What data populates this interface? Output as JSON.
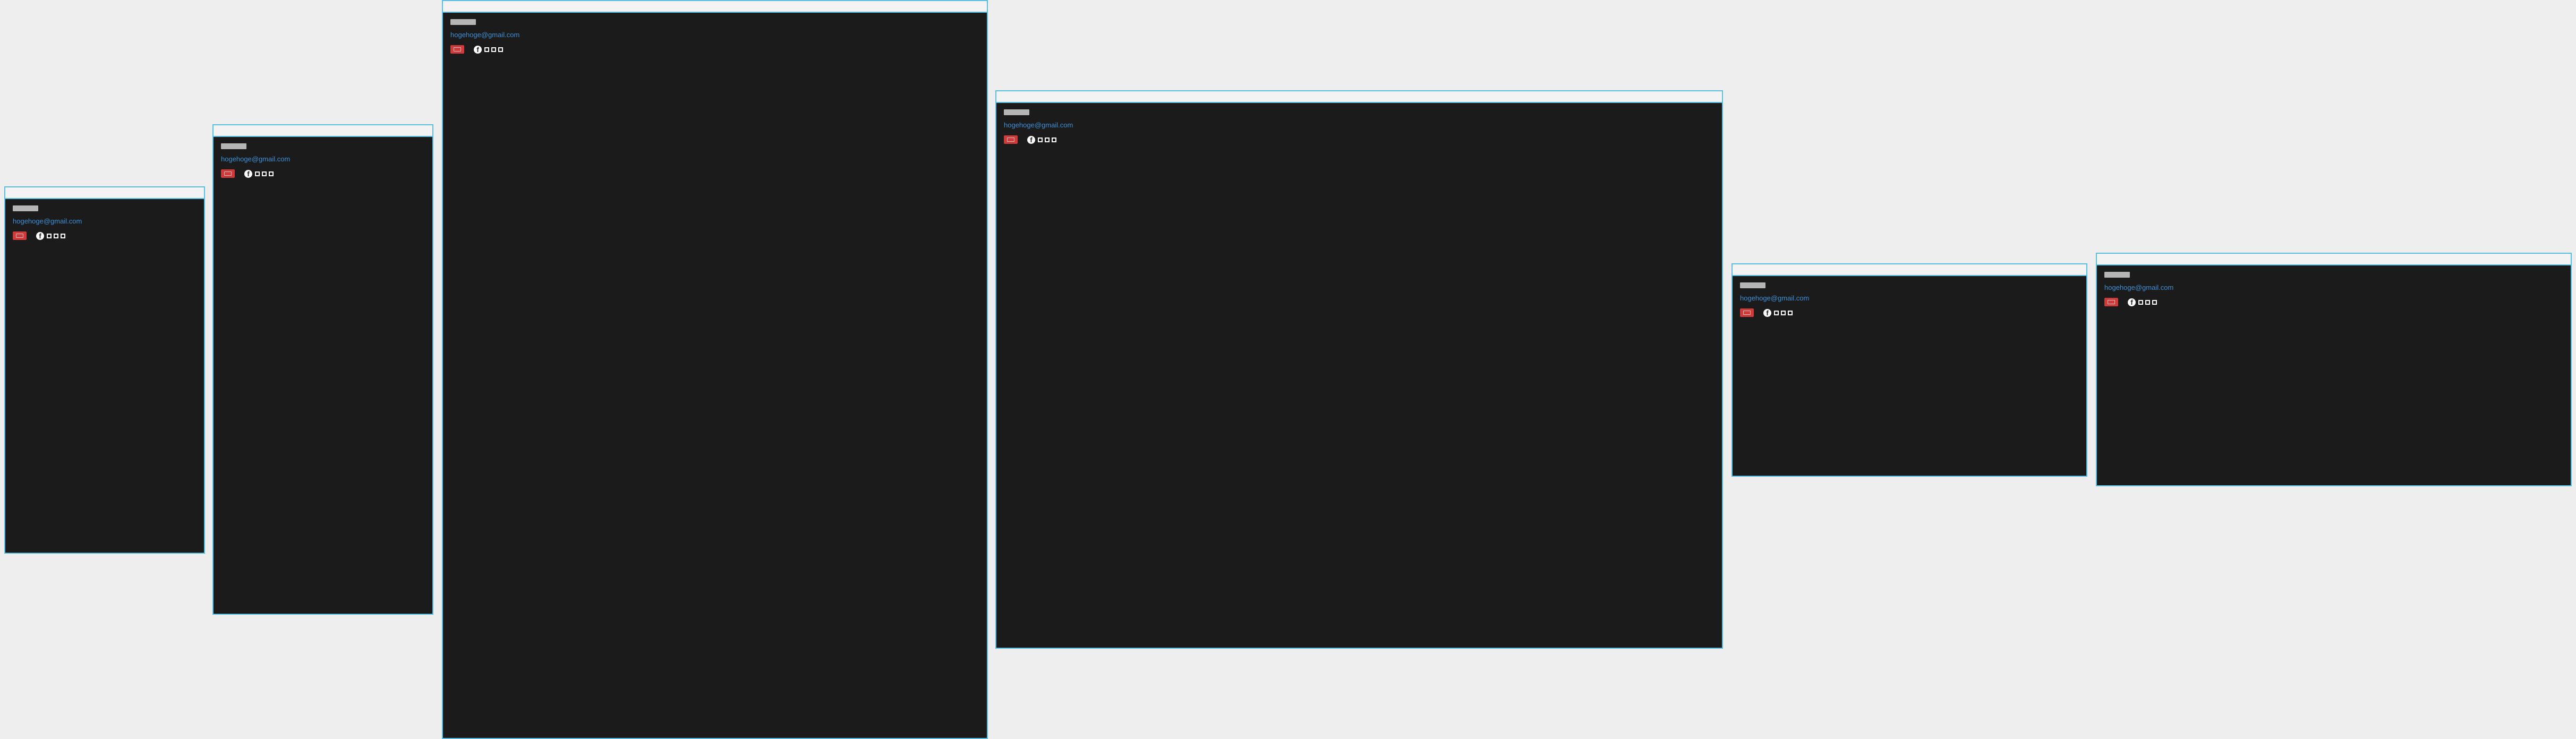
{
  "windows": [
    {
      "title": "",
      "email": "hogehoge@gmail.com",
      "name_label": ""
    },
    {
      "title": "",
      "email": "hogehoge@gmail.com",
      "name_label": ""
    },
    {
      "title": "",
      "email": "hogehoge@gmail.com",
      "name_label": ""
    },
    {
      "title": "",
      "email": "hogehoge@gmail.com",
      "name_label": ""
    },
    {
      "title": "",
      "email": "hogehoge@gmail.com",
      "name_label": ""
    },
    {
      "title": "",
      "email": "hogehoge@gmail.com",
      "name_label": ""
    }
  ],
  "icons": {
    "mail": "gmail-icon",
    "facebook": "facebook-icon",
    "facebook_glyph": "f",
    "share": "share-square-icon"
  },
  "colors": {
    "background": "#eeeeee",
    "panel": "#1b1b1b",
    "border": "#5bbde0",
    "link": "#3f8fd6",
    "gmail_badge": "#cf3a3a"
  }
}
